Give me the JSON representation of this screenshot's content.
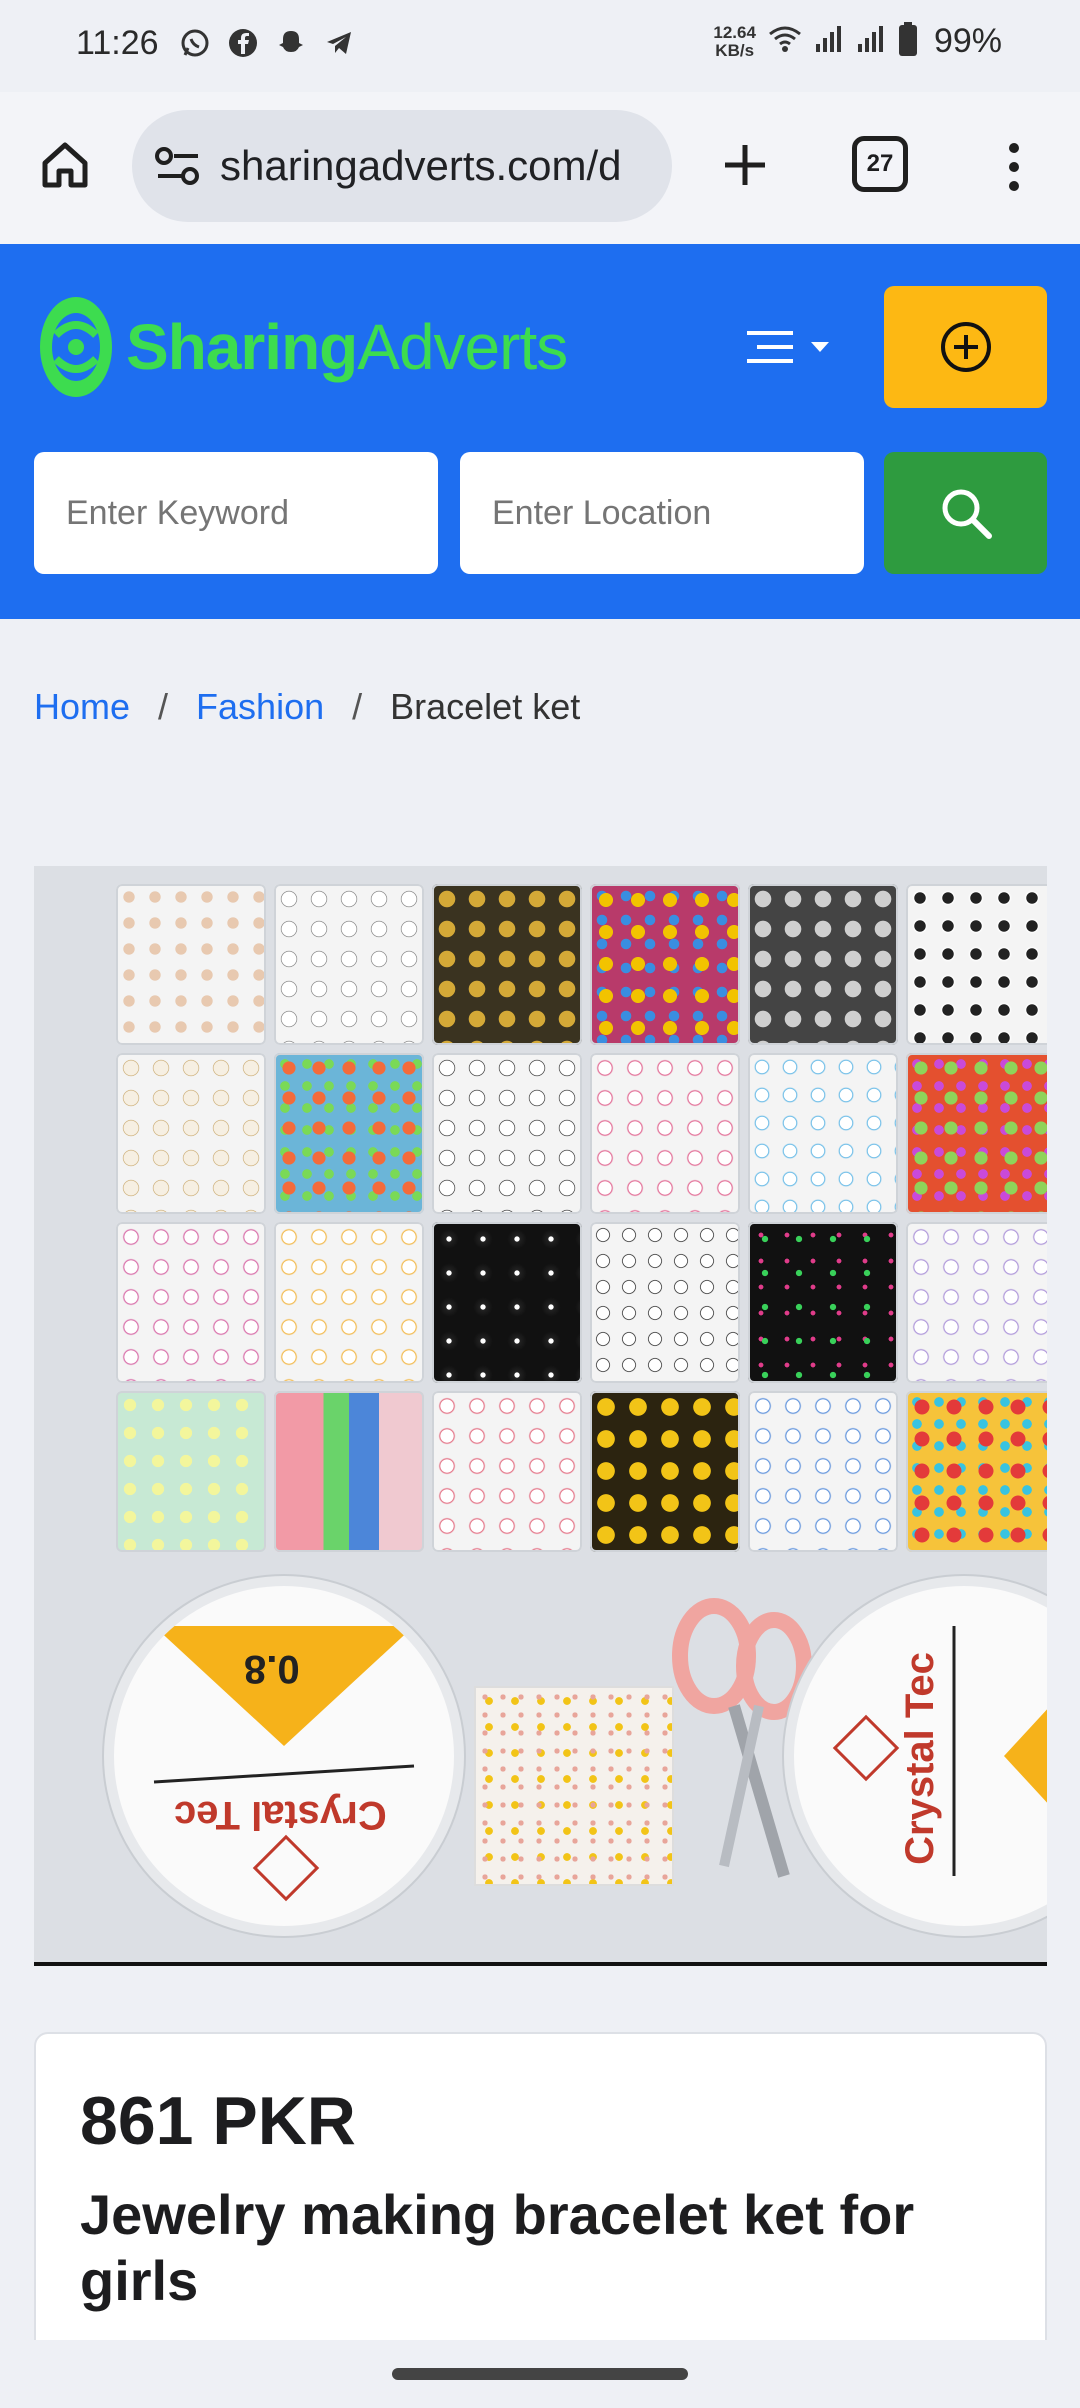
{
  "status_bar": {
    "time": "11:26",
    "net_speed_value": "12.64",
    "net_speed_unit": "KB/s",
    "battery": "99%",
    "apps": [
      "whatsapp-icon",
      "facebook-icon",
      "snapchat-icon",
      "telegram-icon"
    ]
  },
  "browser": {
    "url": "sharingadverts.com/d",
    "tab_count": "27"
  },
  "site": {
    "logo_part1": "Sharing",
    "logo_part2": "Adverts",
    "brand_blue": "#1e6ef0",
    "brand_green": "#3ddc4f",
    "post_button_color": "#fdb813",
    "search_button_color": "#2e9b3f"
  },
  "search": {
    "keyword_placeholder": "Enter Keyword",
    "location_placeholder": "Enter Location"
  },
  "breadcrumb": {
    "home": "Home",
    "category": "Fashion",
    "current": "Bracelet ket",
    "separator": "/"
  },
  "product": {
    "price": "861 PKR",
    "title": "Jewelry making bracelet ket for girls",
    "image_spool_brand": "Crystal Tec",
    "image_spool_size": "0.8"
  }
}
